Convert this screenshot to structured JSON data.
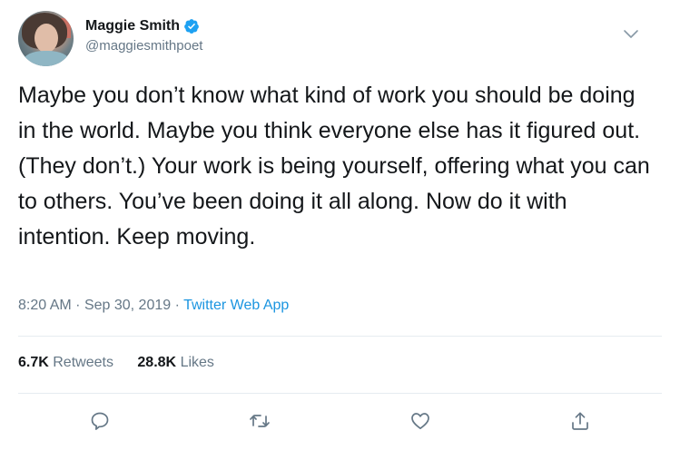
{
  "author": {
    "display_name": "Maggie Smith",
    "handle": "@maggiesmithpoet",
    "verified": true,
    "avatar_icon": "profile-photo"
  },
  "tweet": {
    "text": "Maybe you don’t know what kind of work you should be doing in the world. Maybe you think everyone else has it figured out. (They don’t.) Your work is being yourself, offering what you can to others. You’ve been doing it all along. Now do it with intention. Keep moving.",
    "time": "8:20 AM",
    "date": "Sep 30, 2019",
    "separator": "·",
    "source": "Twitter Web App"
  },
  "stats": {
    "retweets_count": "6.7K",
    "retweets_label": "Retweets",
    "likes_count": "28.8K",
    "likes_label": "Likes"
  },
  "actions": [
    {
      "name": "reply",
      "icon": "speech-bubble-icon"
    },
    {
      "name": "retweet",
      "icon": "retweet-icon"
    },
    {
      "name": "like",
      "icon": "heart-icon"
    },
    {
      "name": "share",
      "icon": "share-icon"
    }
  ],
  "colors": {
    "link": "#1b95e0",
    "muted": "#657786",
    "text": "#14171a",
    "verified": "#1da1f2",
    "divider": "#e6ecf0"
  }
}
